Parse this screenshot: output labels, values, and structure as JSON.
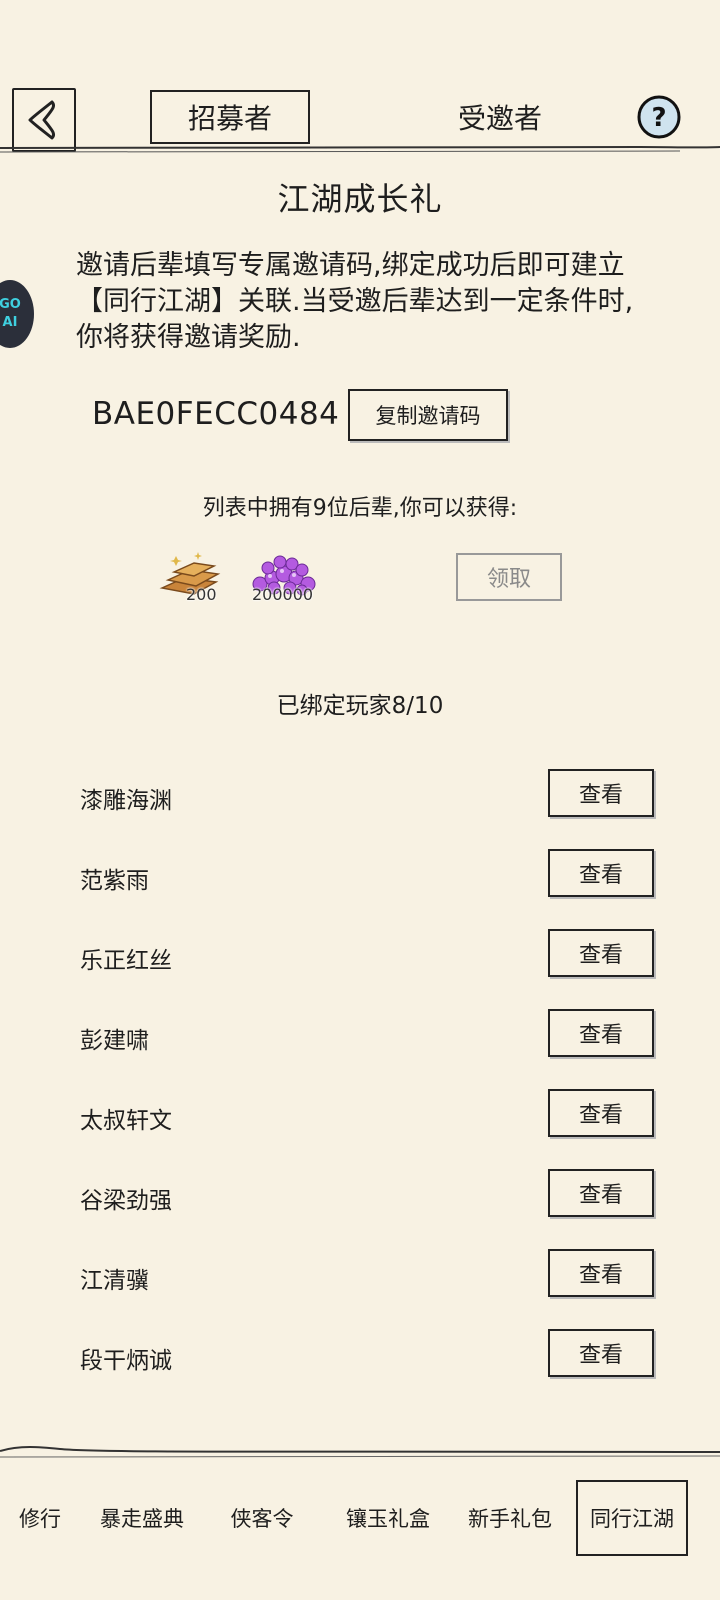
{
  "header": {
    "back_icon": "back-arrow-icon",
    "tabs": [
      {
        "label": "招募者",
        "active": true
      },
      {
        "label": "受邀者",
        "active": false
      }
    ],
    "help_icon": "question-mark-icon"
  },
  "main": {
    "title": "江湖成长礼",
    "description": "邀请后辈填写专属邀请码,绑定成功后即可建立【同行江湖】关联.当受邀后辈达到一定条件时,你将获得邀请奖励.",
    "invite_code": "BAE0FECC0484",
    "copy_button": "复制邀请码",
    "list_info": "列表中拥有9位后辈,你可以获得:",
    "rewards": [
      {
        "icon": "gold-ingot-icon",
        "amount": "200"
      },
      {
        "icon": "purple-gems-icon",
        "amount": "200000"
      }
    ],
    "claim_button": "领取",
    "bound_count": "已绑定玩家8/10"
  },
  "players": [
    {
      "name": "漆雕海渊",
      "action": "查看"
    },
    {
      "name": "范紫雨",
      "action": "查看"
    },
    {
      "name": "乐正红丝",
      "action": "查看"
    },
    {
      "name": "彭建啸",
      "action": "查看"
    },
    {
      "name": "太叔轩文",
      "action": "查看"
    },
    {
      "name": "谷梁劲强",
      "action": "查看"
    },
    {
      "name": "江清骥",
      "action": "查看"
    },
    {
      "name": "段干炳诚",
      "action": "查看"
    }
  ],
  "bottom_nav": [
    {
      "label": "修行",
      "active": false
    },
    {
      "label": "暴走盛典",
      "active": false
    },
    {
      "label": "侠客令",
      "active": false
    },
    {
      "label": "镶玉礼盒",
      "active": false
    },
    {
      "label": "新手礼包",
      "active": false
    },
    {
      "label": "同行江湖",
      "active": true
    }
  ],
  "colors": {
    "background": "#f8f2e3",
    "ink": "#1e1e1e",
    "disabled": "#8a8a8a"
  }
}
